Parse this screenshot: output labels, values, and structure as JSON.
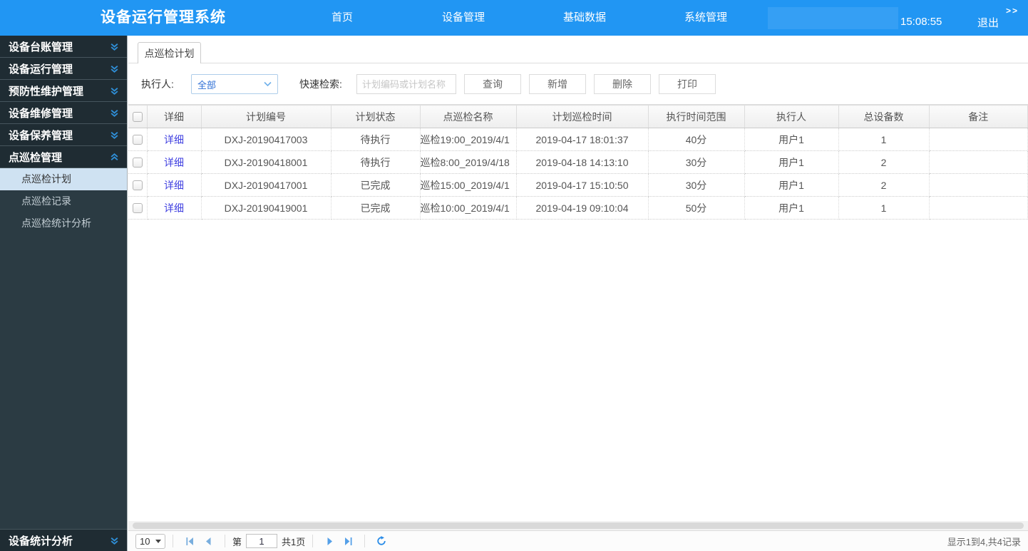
{
  "app": {
    "title": "设备运行管理系统"
  },
  "header": {
    "nav": [
      {
        "label": "首页"
      },
      {
        "label": "设备管理"
      },
      {
        "label": "基础数据"
      },
      {
        "label": "系统管理"
      }
    ],
    "time": "15:08:55",
    "logout_label": "退出",
    "collapse_label": ">>"
  },
  "sidebar": {
    "menus": [
      {
        "label": "设备台账管理",
        "expanded": false
      },
      {
        "label": "设备运行管理",
        "expanded": false
      },
      {
        "label": "预防性维护管理",
        "expanded": false
      },
      {
        "label": "设备维修管理",
        "expanded": false
      },
      {
        "label": "设备保养管理",
        "expanded": false
      },
      {
        "label": "点巡检管理",
        "expanded": true,
        "children": [
          {
            "label": "点巡检计划",
            "selected": true
          },
          {
            "label": "点巡检记录",
            "selected": false
          },
          {
            "label": "点巡检统计分析",
            "selected": false
          }
        ]
      }
    ],
    "bottom_menu": {
      "label": "设备统计分析",
      "expanded": false
    }
  },
  "tab": {
    "label": "点巡检计划"
  },
  "filters": {
    "executor_label": "执行人:",
    "executor_value": "全部",
    "search_label": "快速检索:",
    "search_placeholder": "计划编码或计划名称",
    "buttons": [
      "查询",
      "新增",
      "删除",
      "打印"
    ]
  },
  "table": {
    "columns": [
      "详细",
      "计划编号",
      "计划状态",
      "点巡检名称",
      "计划巡检时间",
      "执行时间范围",
      "执行人",
      "总设备数",
      "备注"
    ],
    "rows": [
      [
        "详细",
        "DXJ-20190417003",
        "待执行",
        "巡检19:00_2019/4/1",
        "2019-04-17 18:01:37",
        "40分",
        "用户1",
        "1",
        ""
      ],
      [
        "详细",
        "DXJ-20190418001",
        "待执行",
        "巡检8:00_2019/4/18",
        "2019-04-18 14:13:10",
        "30分",
        "用户1",
        "2",
        ""
      ],
      [
        "详细",
        "DXJ-20190417001",
        "已完成",
        "巡检15:00_2019/4/1",
        "2019-04-17 15:10:50",
        "30分",
        "用户1",
        "2",
        ""
      ],
      [
        "详细",
        "DXJ-20190419001",
        "已完成",
        "巡检10:00_2019/4/1",
        "2019-04-19 09:10:04",
        "50分",
        "用户1",
        "1",
        ""
      ]
    ]
  },
  "pagination": {
    "page_size": "10",
    "page_prefix": "第",
    "current_page": "1",
    "page_suffix": "共1页",
    "summary": "显示1到4,共4记录"
  },
  "colors": {
    "header_bg": "#2196f3",
    "sidebar_header_bg": "#1f2c33",
    "sidebar_panel_bg": "#2b3b43",
    "selected_item_bg": "#cfe2f2",
    "detail_link": "#4040e0",
    "combobox_text": "#2e6fd6"
  }
}
